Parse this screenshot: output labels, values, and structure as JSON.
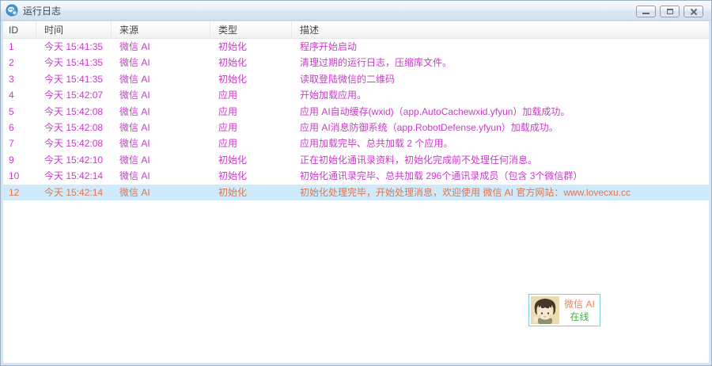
{
  "window": {
    "title": "运行日志",
    "controls": [
      {
        "name": "minimize"
      },
      {
        "name": "maximize"
      },
      {
        "name": "close"
      }
    ]
  },
  "table": {
    "columns": [
      "ID",
      "时间",
      "来源",
      "类型",
      "描述"
    ],
    "rows": [
      {
        "id": "1",
        "time": "今天 15:41:35",
        "source": "微信 AI",
        "type": "初始化",
        "desc": "程序开始启动",
        "highlighted": false
      },
      {
        "id": "2",
        "time": "今天 15:41:35",
        "source": "微信 AI",
        "type": "初始化",
        "desc": "清理过期的运行日志，压缩库文件。",
        "highlighted": false
      },
      {
        "id": "3",
        "time": "今天 15:41:35",
        "source": "微信 AI",
        "type": "初始化",
        "desc": "读取登陆微信的二维码",
        "highlighted": false
      },
      {
        "id": "4",
        "time": "今天 15:42:07",
        "source": "微信 AI",
        "type": "应用",
        "desc": "开始加载应用。",
        "highlighted": false
      },
      {
        "id": "5",
        "time": "今天 15:42:08",
        "source": "微信 AI",
        "type": "应用",
        "desc": "应用 AI自动缓存(wxid)（app.AutoCachewxid.yfyun）加载成功。",
        "highlighted": false
      },
      {
        "id": "6",
        "time": "今天 15:42:08",
        "source": "微信 AI",
        "type": "应用",
        "desc": "应用 AI消息防御系统（app.RobotDefense.yfyun）加载成功。",
        "highlighted": false
      },
      {
        "id": "7",
        "time": "今天 15:42:08",
        "source": "微信 AI",
        "type": "应用",
        "desc": "应用加载完毕、总共加载 2 个应用。",
        "highlighted": false
      },
      {
        "id": "9",
        "time": "今天 15:42:10",
        "source": "微信 AI",
        "type": "初始化",
        "desc": "正在初始化通讯录资料，初始化完成前不处理任何消息。",
        "highlighted": false
      },
      {
        "id": "10",
        "time": "今天 15:42:14",
        "source": "微信 AI",
        "type": "初始化",
        "desc": "初始化通讯录完毕、总共加载 296个通讯录成员（包含 3个微信群）",
        "highlighted": false
      },
      {
        "id": "12",
        "time": "今天 15:42:14",
        "source": "微信 AI",
        "type": "初始化",
        "desc": "初始化处理完毕，开始处理消息，欢迎使用 微信 AI 官方网站：www.lovecxu.cc",
        "highlighted": true
      }
    ]
  },
  "status_widget": {
    "name": "微信 AI",
    "status": "在线"
  },
  "icons": {
    "app_icon": "app-logo-icon",
    "minimize": "minimize-icon",
    "maximize": "maximize-icon",
    "close": "close-icon",
    "avatar": "bot-avatar-image"
  },
  "colors": {
    "log_text": "#cb3acb",
    "highlight_bg": "#cfeafa",
    "highlight_text": "#e4744d",
    "online_green": "#3db53d",
    "name_red": "#ee7e60",
    "widget_border": "#82c6ea"
  }
}
